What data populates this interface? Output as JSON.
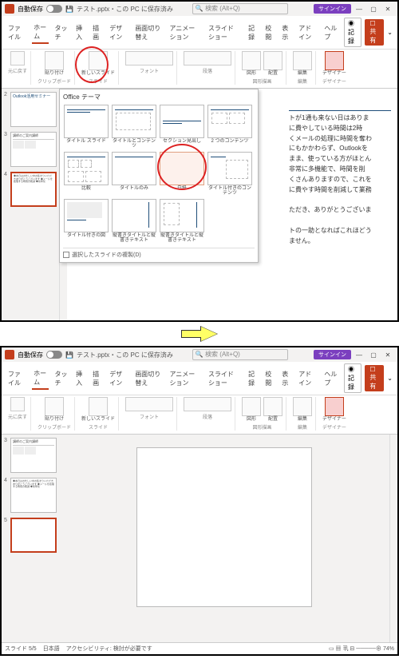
{
  "title": {
    "autosave": "自動保存",
    "saveicon": "⎙",
    "filename": "テスト.pptx・この PC に保存済み",
    "search_ph": "検索 (Alt+Q)",
    "signin": "サインイン"
  },
  "tabs": [
    "ファイル",
    "ホーム",
    "タッチ",
    "挿入",
    "描画",
    "デザイン",
    "画面切り替え",
    "アニメーション",
    "スライド ショー",
    "記録",
    "校閲",
    "表示",
    "アドイン",
    "ヘルプ"
  ],
  "tabright": {
    "record": "記録",
    "share": "共有"
  },
  "ribbon": {
    "undo": "元に戻す",
    "clipboard": "クリップボード",
    "slides": "スライド",
    "newslide": "新しいスライド",
    "font": "フォント",
    "para": "段落",
    "drawing": "図形描画",
    "edit": "編集",
    "designer": "デザイナー",
    "shape": "図形",
    "arrange": "配置"
  },
  "gallery": {
    "head": "Office テーマ",
    "items": [
      "タイトル スライド",
      "タイトルとコンテンツ",
      "セクション見出し",
      "2 つのコンテンツ",
      "比較",
      "タイトルのみ",
      "白紙",
      "タイトル付きのコンテンツ",
      "タイトル付きの図",
      "縦書きタイトルと縦書きテキスト",
      "縦書きタイトルと縦書きテキスト"
    ],
    "foot": "選択したスライドの複製(D)"
  },
  "doc": {
    "lines": [
      "トが1通も来ない日はありま",
      "に費やしている時間は2時",
      "くメールの処理に時間を奪わ",
      "にもかかわらず、Outlookを",
      "まま、使っている方がほとん",
      "非常に多機能で、時間を削",
      "くさんありますので、これを",
      "に費やす時間を削減して業務",
      "",
      "ただき、ありがとうございま",
      "",
      "トの一助となればこれほどう",
      "ません。"
    ]
  },
  "thumbs": {
    "t3": "講師のご案内講師",
    "t4": "◆本日はお忙しい中お集まりいただきありがとうございます ◆メールを処理する時間の削減 ◆効率化"
  },
  "status": {
    "slide": "スライド 5/5",
    "lang": "日本語",
    "a11y": "アクセシビリティ: 検討が必要です"
  }
}
